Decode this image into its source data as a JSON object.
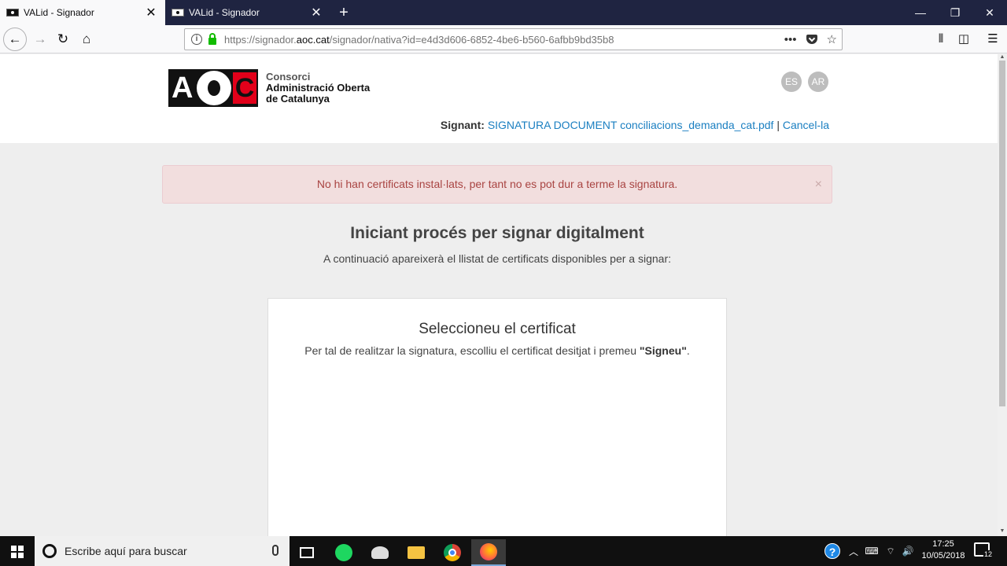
{
  "browser": {
    "tabs": [
      {
        "title": "VALid - Signador",
        "active": true
      },
      {
        "title": "VALid - Signador",
        "active": false
      }
    ],
    "new_tab_label": "+",
    "url_prefix": "https://signador.",
    "url_domain": "aoc.cat",
    "url_suffix": "/signador/nativa?id=e4d3d606-6852-4be6-b560-6afbb9bd35b8",
    "page_actions_label": "•••"
  },
  "header": {
    "logo_letters": [
      "A",
      "C"
    ],
    "logo_line1": "Consorci",
    "logo_line2": "Administració Oberta",
    "logo_line3": "de Catalunya",
    "languages": [
      "ES",
      "AR"
    ],
    "signant_label": "Signant:",
    "signant_document": "SIGNATURA DOCUMENT conciliacions_demanda_cat.pdf",
    "separator": "|",
    "cancel_label": "Cancel-la"
  },
  "alert": {
    "message": "No hi han certificats instal·lats, per tant no es pot dur a terme la signatura.",
    "close_label": "×"
  },
  "main": {
    "title": "Iniciant procés per signar digitalment",
    "subtitle": "A continuació apareixerà el llistat de certificats disponibles per a signar:"
  },
  "card": {
    "title": "Seleccioneu el certificat",
    "text_before": "Per tal de realitzar la signatura, escolliu el certificat desitjat i premeu ",
    "text_bold": "\"Signeu\"",
    "text_after": "."
  },
  "taskbar": {
    "search_placeholder": "Escribe aquí para buscar",
    "time": "17:25",
    "date": "10/05/2018",
    "notification_count": "12"
  },
  "colors": {
    "link": "#1a7fc1",
    "alert_bg": "#f2dede",
    "alert_text": "#a94442",
    "tabstrip": "#1f2441"
  }
}
